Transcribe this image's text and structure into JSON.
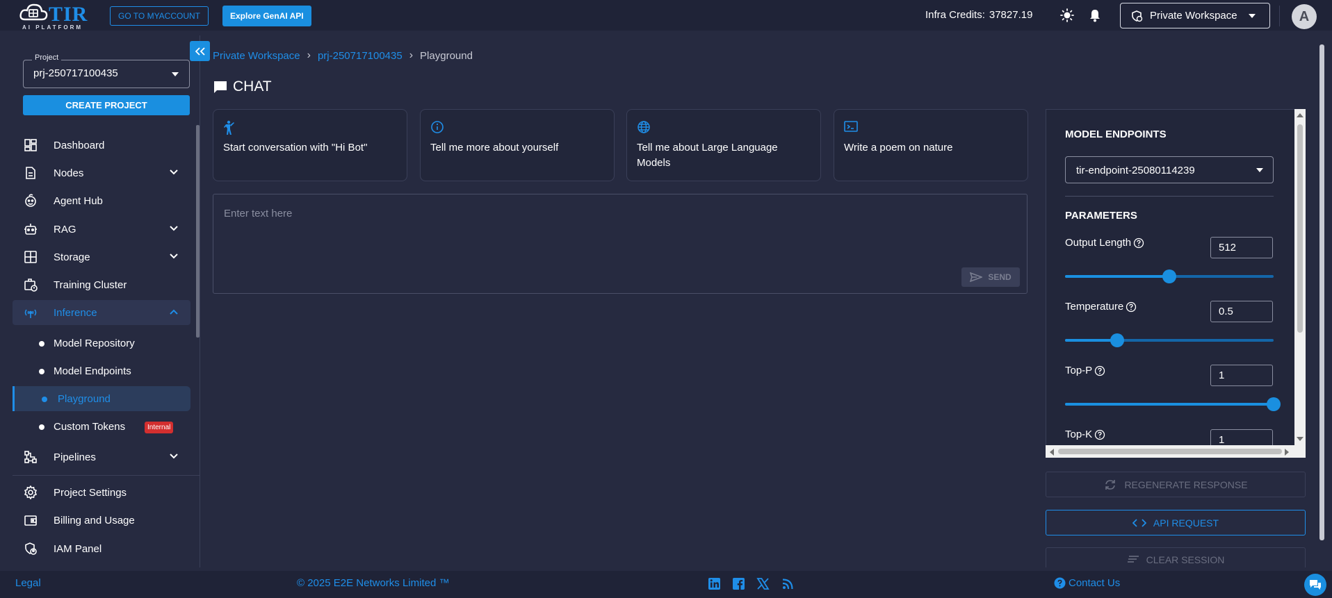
{
  "header": {
    "logo_text": "TIR",
    "logo_subtext": "AI PLATFORM",
    "my_account_label": "GO TO MYACCOUNT",
    "genai_label": "Explore GenAI API",
    "credits_label": "Infra Credits:",
    "credits_value": "37827.19",
    "workspace_label": "Private Workspace",
    "avatar_letter": "A"
  },
  "sidebar": {
    "project_legend": "Project",
    "project_value": "prj-250717100435",
    "create_project_label": "CREATE PROJECT",
    "items": [
      {
        "label": "Dashboard"
      },
      {
        "label": "Nodes"
      },
      {
        "label": "Agent Hub"
      },
      {
        "label": "RAG"
      },
      {
        "label": "Storage"
      },
      {
        "label": "Training Cluster"
      },
      {
        "label": "Inference"
      },
      {
        "label": "Model Repository"
      },
      {
        "label": "Model Endpoints"
      },
      {
        "label": "Playground"
      },
      {
        "label": "Custom Tokens",
        "badge": "Internal"
      },
      {
        "label": "Pipelines"
      },
      {
        "label": "Project Settings"
      },
      {
        "label": "Billing and Usage"
      },
      {
        "label": "IAM Panel"
      }
    ]
  },
  "breadcrumb": {
    "workspace": "Private Workspace",
    "project": "prj-250717100435",
    "current": "Playground",
    "separator": "›"
  },
  "main": {
    "title": "CHAT",
    "prompt_cards": [
      {
        "text": "Start conversation with \"Hi Bot\""
      },
      {
        "text": "Tell me more about yourself"
      },
      {
        "text": "Tell me about Large Language Models"
      },
      {
        "text": "Write a poem on nature"
      }
    ],
    "chat_placeholder": "Enter text here",
    "send_label": "SEND"
  },
  "panel": {
    "endpoints_heading": "MODEL ENDPOINTS",
    "endpoint_value": "tir-endpoint-25080114239",
    "parameters_heading": "PARAMETERS",
    "params": [
      {
        "label": "Output Length",
        "value": "512",
        "slider_fraction": 0.5
      },
      {
        "label": "Temperature",
        "value": "0.5",
        "slider_fraction": 0.25
      },
      {
        "label": "Top-P",
        "value": "1",
        "slider_fraction": 1.0
      },
      {
        "label": "Top-K",
        "value": "1"
      }
    ],
    "regenerate_label": "REGENERATE RESPONSE",
    "api_request_label": "API REQUEST",
    "clear_session_label": "CLEAR SESSION"
  },
  "footer": {
    "legal": "Legal",
    "copyright": "© 2025 E2E Networks Limited ™",
    "contact": "Contact Us",
    "social_icons": [
      "linkedin-icon",
      "facebook-icon",
      "x-icon",
      "rss-icon"
    ]
  },
  "colors": {
    "accent": "#1a8fe0",
    "background": "#262a40",
    "topbar": "#1f2337",
    "danger_badge": "#d32f2f"
  }
}
